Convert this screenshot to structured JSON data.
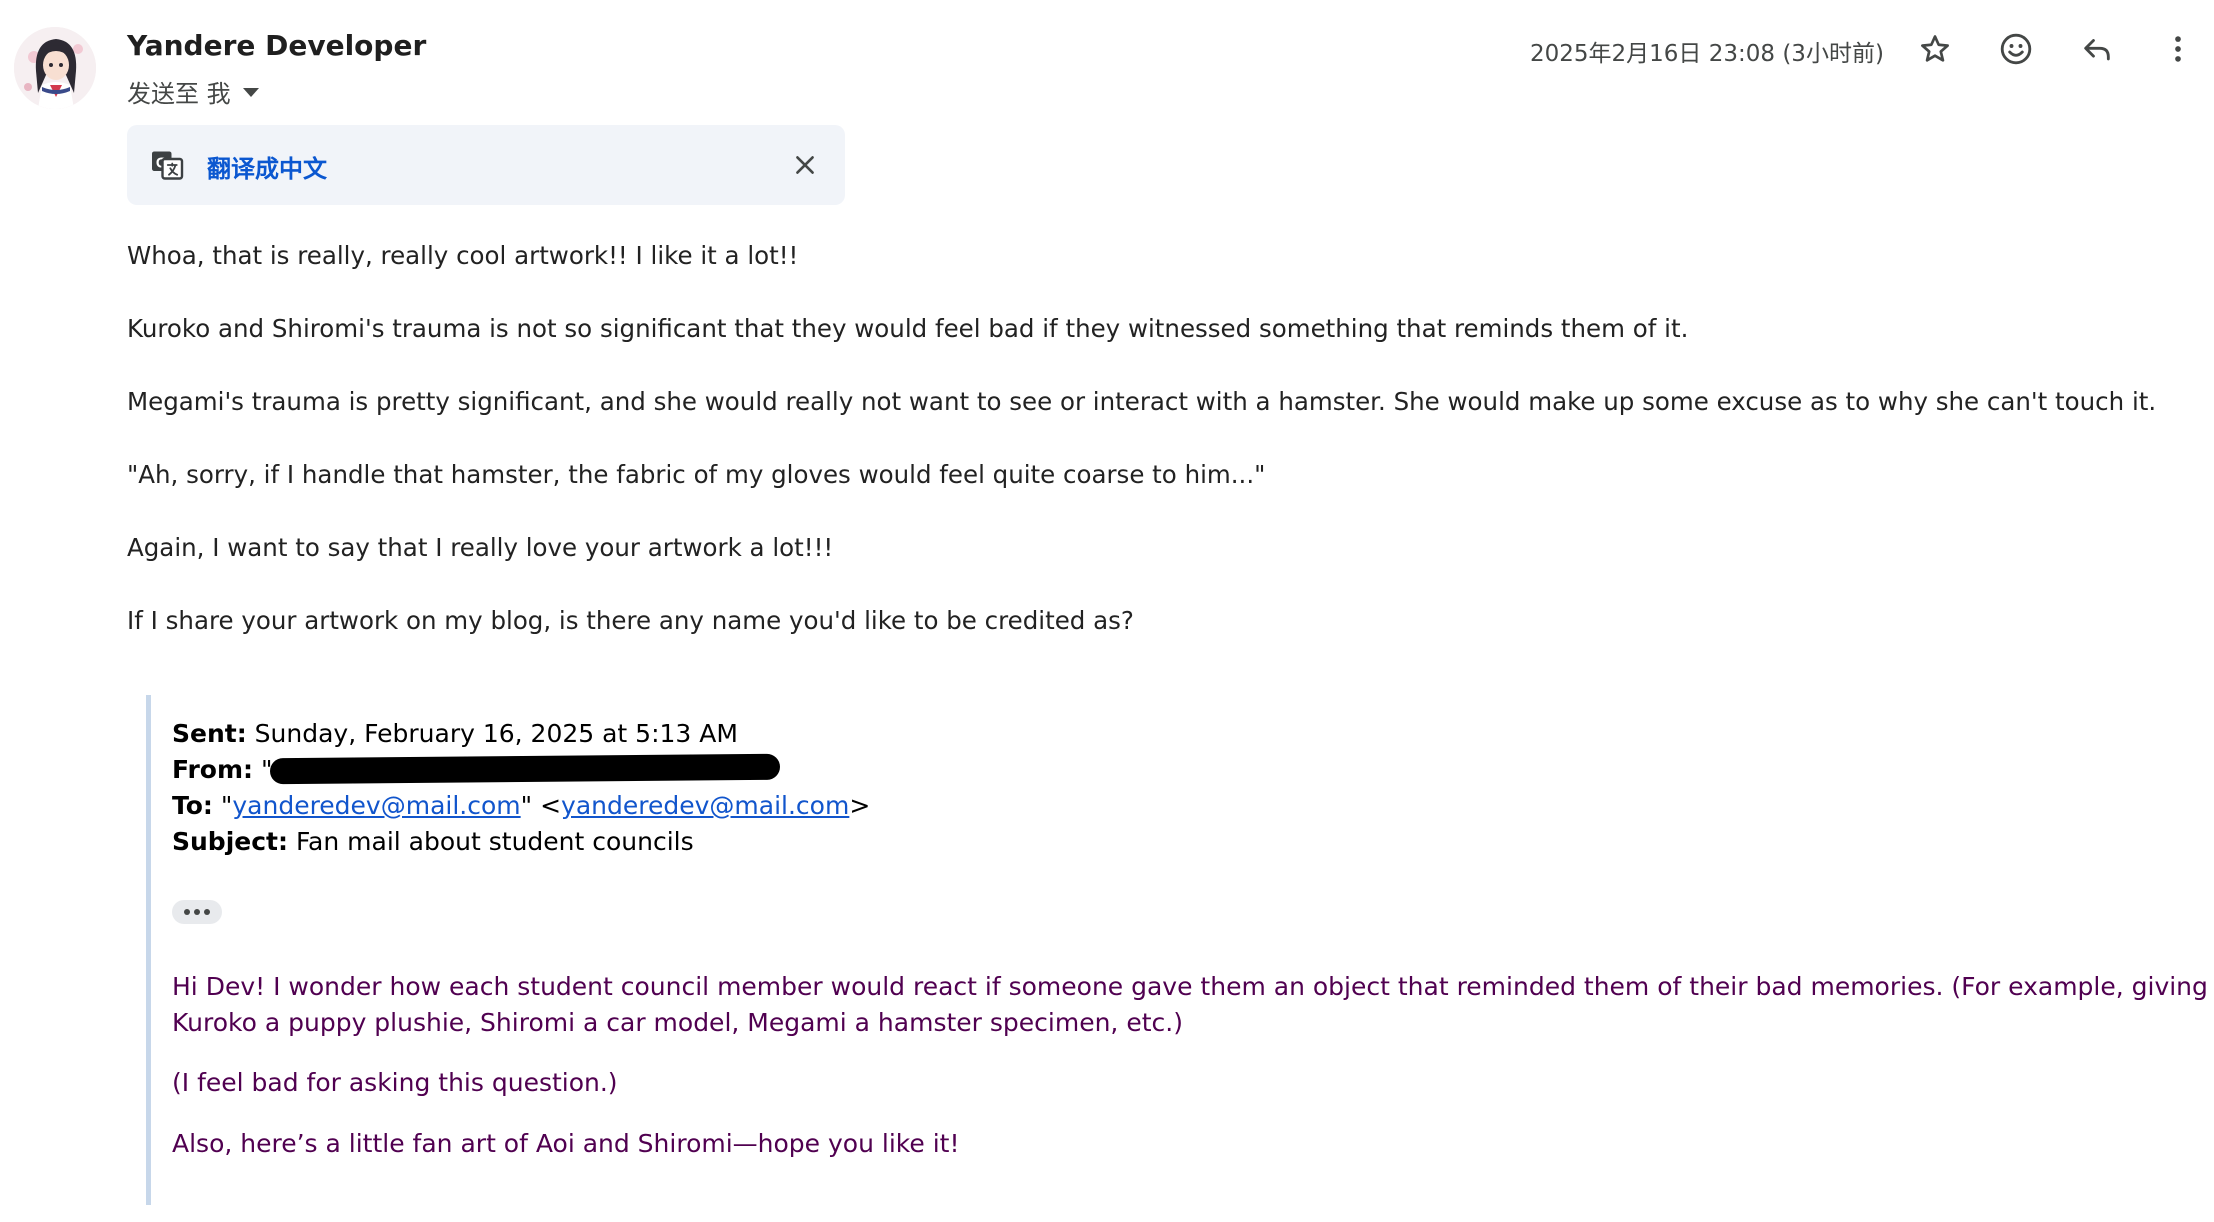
{
  "header": {
    "sender_name": "Yandere Developer",
    "recipient_label": "发送至 我",
    "timestamp": "2025年2月16日 23:08 (3小时前)"
  },
  "icons": {
    "star": "star-icon",
    "emoji": "emoji-icon",
    "reply": "reply-icon",
    "more": "more-vert-icon",
    "translate": "translate-icon",
    "close": "close-icon"
  },
  "translate": {
    "link_label": "翻译成中文"
  },
  "body": {
    "paragraphs": [
      "Whoa, that is really, really cool artwork!! I like it a lot!!",
      "Kuroko and Shiromi's trauma is not so significant that they would feel bad if they witnessed something that reminds them of it.",
      "Megami's trauma is pretty significant, and she would really not want to see or interact with a hamster. She would make up some excuse as to why she can't touch it.",
      "\"Ah, sorry, if I handle that hamster, the fabric of my gloves would feel quite coarse to him...\"",
      "Again, I want to say that I really love your artwork a lot!!!",
      "If I share your artwork on my blog, is there any name you'd like to be credited as?"
    ]
  },
  "quoted": {
    "sent_label": "Sent:",
    "sent_value": "Sunday, February 16, 2025 at 5:13 AM",
    "from_label": "From:",
    "from_prefix": "\"",
    "to_label": "To:",
    "to_quote_open": "\"",
    "to_name_link": "yanderedev@mail.com",
    "to_mid": "\" <",
    "to_email_link": "yanderedev@mail.com",
    "to_close": ">",
    "subject_label": "Subject:",
    "subject_value": "Fan mail about student councils",
    "message_line1": "Hi Dev! I wonder how each student council member would react if someone gave them an object that reminded them of their bad memories. (For example, giving",
    "message_line2": "Kuroko a puppy plushie, Shiromi a car model, Megami a hamster specimen, etc.)",
    "message_line3": "(I feel bad for asking this question.)",
    "message_line4": "Also, here’s a little fan art of Aoi and Shiromi—hope you like it!"
  },
  "colors": {
    "link_blue": "#0b57d0",
    "quote_purple": "#500050",
    "quote_bar": "#c7d7ea",
    "translate_bg": "#f1f4f9"
  }
}
